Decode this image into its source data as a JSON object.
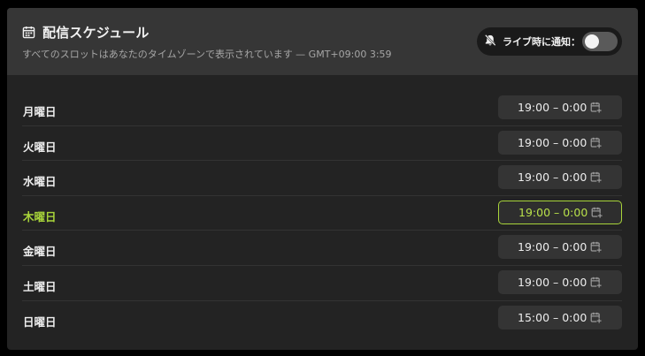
{
  "header": {
    "title": "配信スケジュール",
    "subtitle": "すべてのスロットはあなたのタイムゾーンで表示されています — GMT+09:00 3:59",
    "notify_label": "ライブ時に通知：",
    "notify_enabled": false
  },
  "colors": {
    "accent": "#a8d43a",
    "panel": "#232323",
    "header": "#363636"
  },
  "icons": {
    "title": "calendar-icon",
    "notify": "bell-off-icon",
    "slot": "calendar-add-icon"
  },
  "schedule": [
    {
      "day": "月曜日",
      "time": "19:00 – 0:00",
      "today": false
    },
    {
      "day": "火曜日",
      "time": "19:00 – 0:00",
      "today": false
    },
    {
      "day": "水曜日",
      "time": "19:00 – 0:00",
      "today": false
    },
    {
      "day": "木曜日",
      "time": "19:00 – 0:00",
      "today": true
    },
    {
      "day": "金曜日",
      "time": "19:00 – 0:00",
      "today": false
    },
    {
      "day": "土曜日",
      "time": "19:00 – 0:00",
      "today": false
    },
    {
      "day": "日曜日",
      "time": "15:00 – 0:00",
      "today": false
    }
  ]
}
